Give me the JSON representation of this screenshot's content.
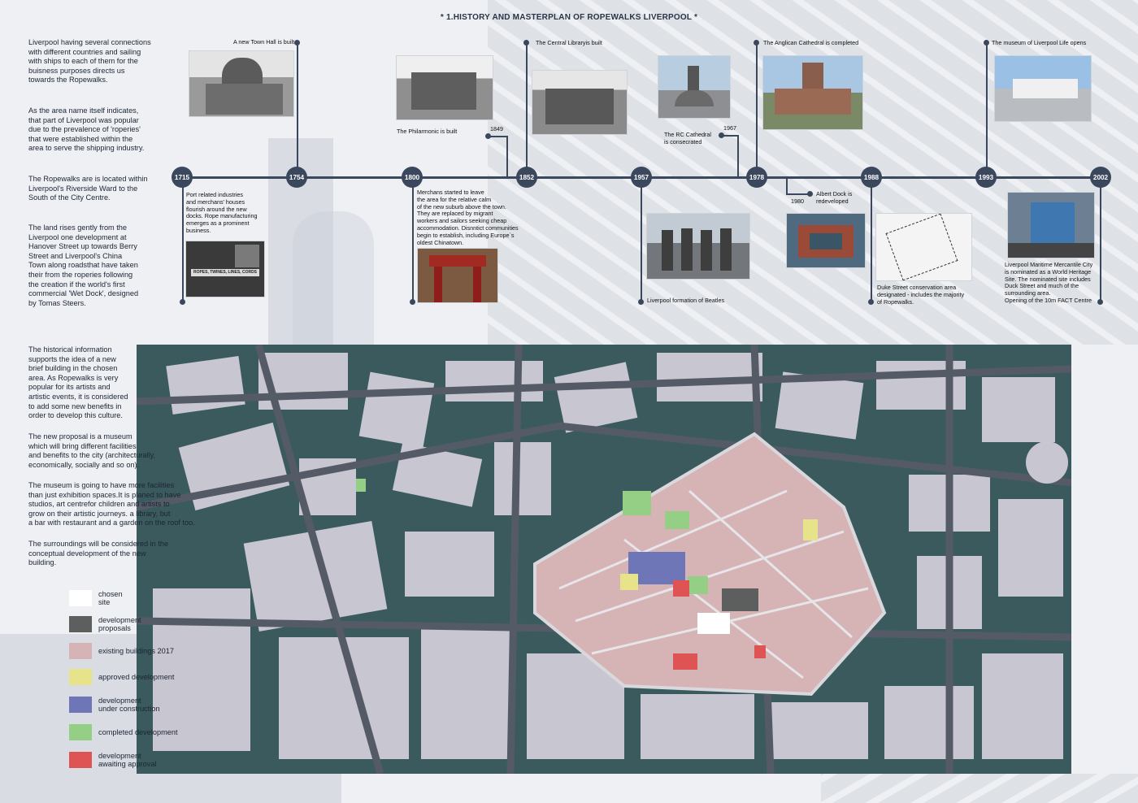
{
  "title": "* 1.HISTORY AND MASTERPLAN OF ROPEWALKS LIVERPOOL *",
  "intro_paragraphs": [
    "Liverpool having several connections\nwith different countries and sailing\nwith ships to each of them for the\nbuisness purposes directs us\ntowards the Ropewalks.",
    "As the area name itself indicates,\nthat part of Liverpool was popular\ndue to the prevalence of 'roperies'\nthat were established within the\narea to serve the shipping industry.",
    "The Ropewalks are is located within\nLiverpool's Riverside Ward to the\nSouth of the City Centre.",
    "The land rises gently from the\nLiverpool one development at\nHanover Street up towards Berry\nStreet and Liverpool's China\nTown along roadsthat have taken\ntheir from the roperies following\nthe creation if the world's first\ncommercial 'Wet Dock', designed\nby Tomas Steers."
  ],
  "proposal_paragraphs": [
    "The historical information\nsupports the idea of a new\nbrief building in the chosen\narea. As Ropewalks is very\npopular for its artists and\nartistic events, it is considered\nto add some new benefits in\norder to develop this culture.",
    "The new proposal is a museum\nwhich will bring different facilities\nand benefits to the city (architecturally,\neconomically, socially and so on).",
    "The museum is going to have more facilities\nthan just exhibition spaces.It is planed to have\nstudios, art centrefor children and artists to\ngrow on their artistic journeys. a library, but\na bar with restaurant and a garden on the roof too.",
    "The surroundings will be considered in the\nconceptual development of the new\nbuilding."
  ],
  "timeline": {
    "years": [
      "1715",
      "1754",
      "1800",
      "1852",
      "1957",
      "1978",
      "1988",
      "1993",
      "2002"
    ],
    "small_years": [
      "1849",
      "1967",
      "1980"
    ],
    "captions": {
      "town_hall": "A new Town Hall is built",
      "port": "Port related industries\nand merchans' houses\nflourish around the new\ndocks. Rope manufacturing\nemerges as a prominent\nbusiness.",
      "philharmonic": "The Philarmonic is built",
      "merchants": "Merchans started to leave\nthe area for the relative calm\nof the new suburb above the town.\nThey are replaced by migrant\nworkers and sailors seeking cheap\naccommodation. Disnntict communities\nbegin to establish, including Europe`s\noldest Chinatown.",
      "central_library": "The Central Libraryis built",
      "beatles": "Liverpool formation of Beatles",
      "rc_cathedral": "The RC Cathedral\nis consecrated",
      "anglican": "The Anglican Cathedral is completed",
      "albert_dock": "Albert Dock is\nredeveloped",
      "duke_street": "Duke Street conservation area\ndesignated - includes the majority\nof Ropewalks.",
      "museum_life": "The museum of Liverpool Life opens",
      "maritime": "Liverpool Maritime Mercantile City\nis nominated as a World Heritage\nSite. The nominated site includes\nDuck Street and much of the\nsurrounding area.\nOpening of the 10m FACT Centre"
    },
    "photo_sign": "ROPES, TWINES, LINES, CORDS"
  },
  "legend": [
    {
      "label": "chosen\nsite",
      "color": "#ffffff"
    },
    {
      "label": "development\nproposals",
      "color": "#5d5f5e"
    },
    {
      "label": "existing buildings 2017",
      "color": "#d6b3b5"
    },
    {
      "label": "approved development",
      "color": "#e6e38a"
    },
    {
      "label": "development\nunder construction",
      "color": "#6f76b8"
    },
    {
      "label": "completed development",
      "color": "#95cf86"
    },
    {
      "label": "development\nawaiting approval",
      "color": "#de5454"
    }
  ],
  "colors": {
    "timeline": "#3b475d",
    "map_ground": "#3a5a5e",
    "map_buildings": "#c8c6d0",
    "roads": "#545b67"
  }
}
